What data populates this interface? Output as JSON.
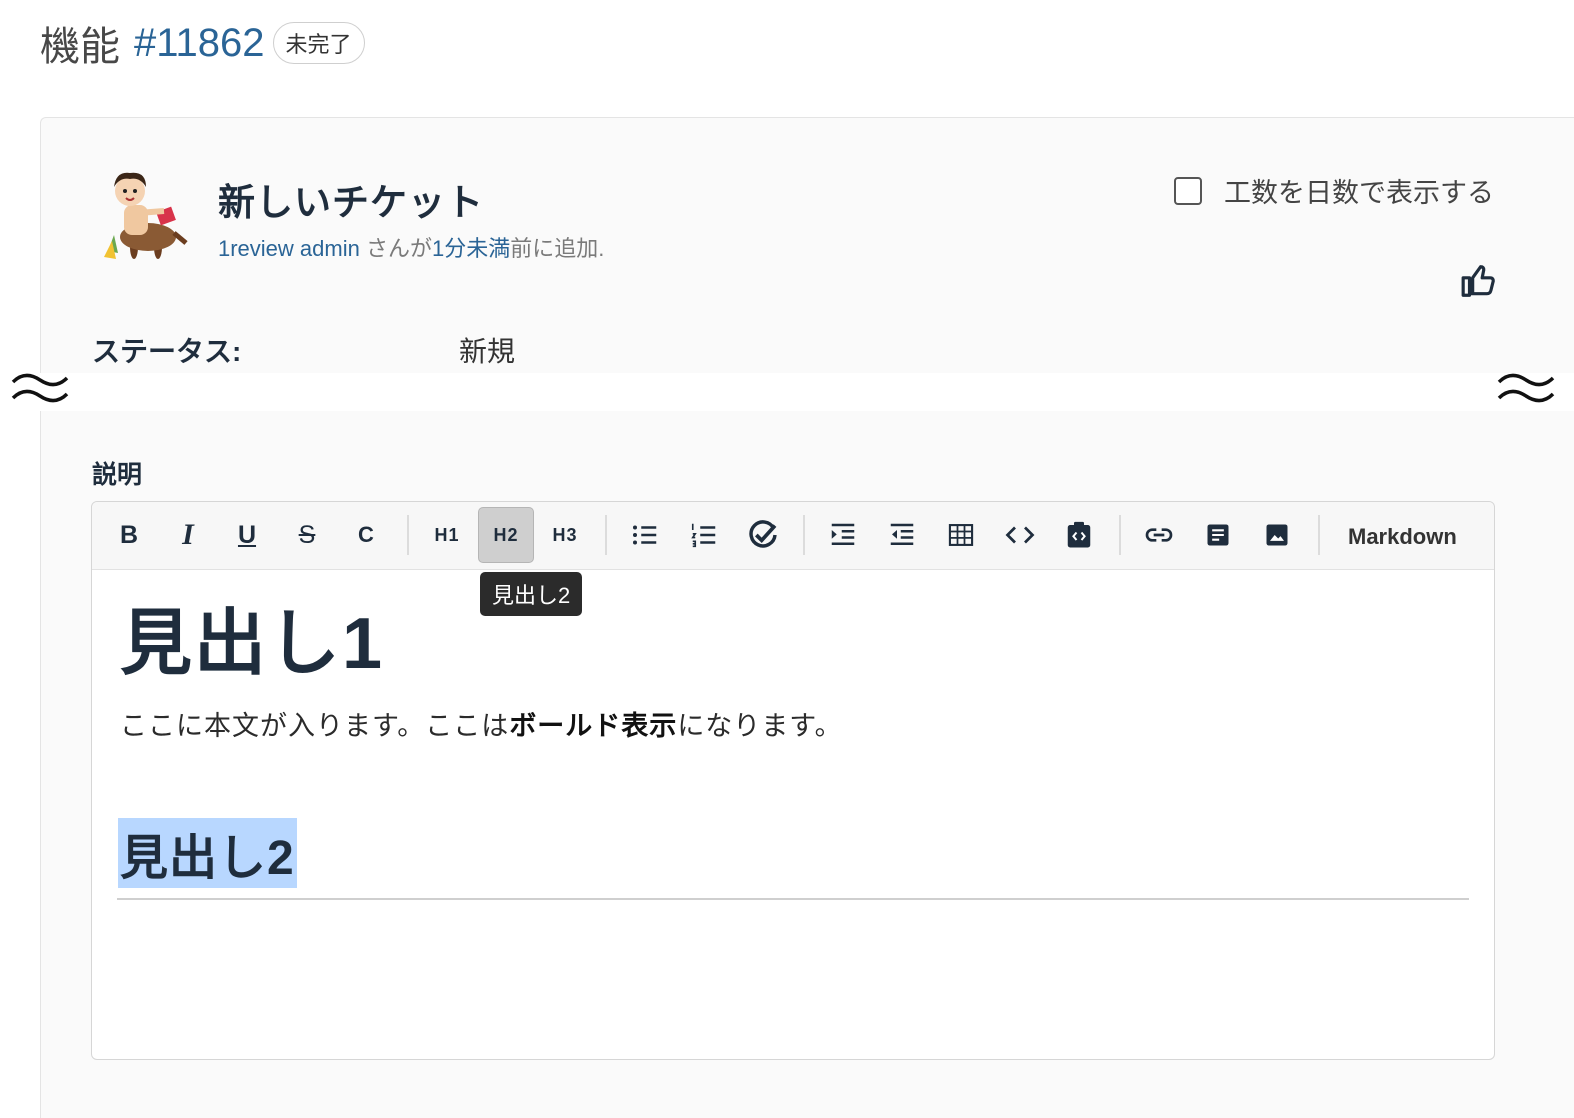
{
  "issue": {
    "tracker": "機能",
    "number": "#11862",
    "status_badge": "未完了",
    "subject": "新しいチケット",
    "author": "1review admin",
    "author_suffix": " さんが",
    "added_time": "1分未満",
    "added_suffix": "前に追加."
  },
  "options": {
    "days_label": "工数を日数で表示する",
    "days_checked": false
  },
  "attributes": {
    "status_label": "ステータス:",
    "status_value": "新規"
  },
  "description": {
    "label": "説明",
    "toolbar": {
      "bold": "B",
      "italic": "I",
      "underline": "U",
      "strike": "S",
      "code": "C",
      "h1": "H1",
      "h2": "H2",
      "h3": "H3",
      "markdown": "Markdown",
      "active": "h2",
      "tooltip": "見出し2"
    },
    "content": {
      "h1": "見出し1",
      "para_before": "ここに本文が入ります。ここは",
      "para_bold": "ボールド表示",
      "para_after": "になります。",
      "h2": "見出し2"
    }
  },
  "colors": {
    "link": "#2a6496",
    "selection": "#b8d7ff",
    "text": "#1f2d3d"
  },
  "icons": [
    "avatar-illustration",
    "thumbs-up-icon",
    "break-mark-icon",
    "bullet-list-icon",
    "numbered-list-icon",
    "task-list-icon",
    "indent-icon",
    "outdent-icon",
    "table-icon",
    "code-icon",
    "code-block-icon",
    "link-icon",
    "document-icon",
    "image-icon"
  ]
}
